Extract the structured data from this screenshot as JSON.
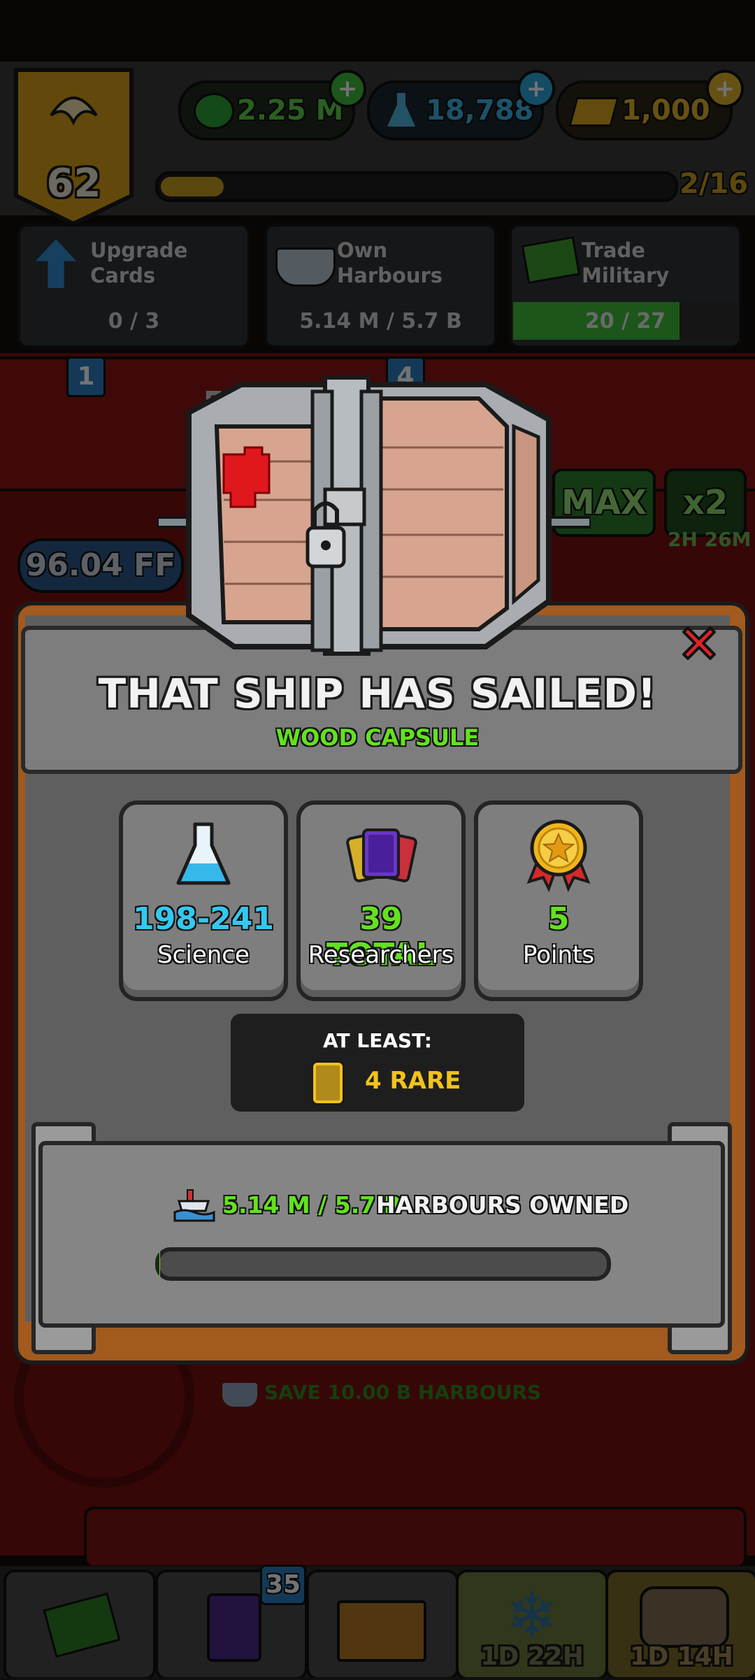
{
  "hud": {
    "level": "62",
    "money": "2.25 M",
    "science": "18,788",
    "gold": "1,000",
    "progress_text": "2/16"
  },
  "actions": [
    {
      "label": "Upgrade Cards",
      "value": "0 / 3"
    },
    {
      "label": "Own Harbours",
      "value": "5.14 M / 5.7 B"
    },
    {
      "label": "Trade Military",
      "value": "20 / 27"
    }
  ],
  "background": {
    "badge_left": "1",
    "badge_mid": "4",
    "count_text": "55",
    "currency_text": "96.04 FF",
    "max_label": "MAX",
    "boost_label": "x2",
    "boost_timer": "2H 26M",
    "save_text": "SAVE 10.00 B HARBOURS",
    "nav_badge": "35",
    "nav_timer_1": "1D 22H",
    "nav_timer_2": "1D 14H"
  },
  "modal": {
    "title": "THAT SHIP HAS SAILED!",
    "subtitle": "WOOD CAPSULE",
    "stats": [
      {
        "value": "198-241",
        "label": "Science",
        "color": "#33c8f0"
      },
      {
        "value": "39 TOTAL",
        "label": "Researchers",
        "color": "#63e21f"
      },
      {
        "value": "5",
        "label": "Points",
        "color": "#63e21f"
      }
    ],
    "at_least_label": "AT LEAST:",
    "rare_text": "4 RARE",
    "requirement_value": "5.14 M / 5.7 B",
    "requirement_text": "HARBOURS OWNED",
    "requirement_progress": 0.0009
  },
  "colors": {
    "green": "#63e21f",
    "blue": "#33c8f0",
    "yellow": "#f2c21b",
    "close_red": "#e0232a"
  }
}
